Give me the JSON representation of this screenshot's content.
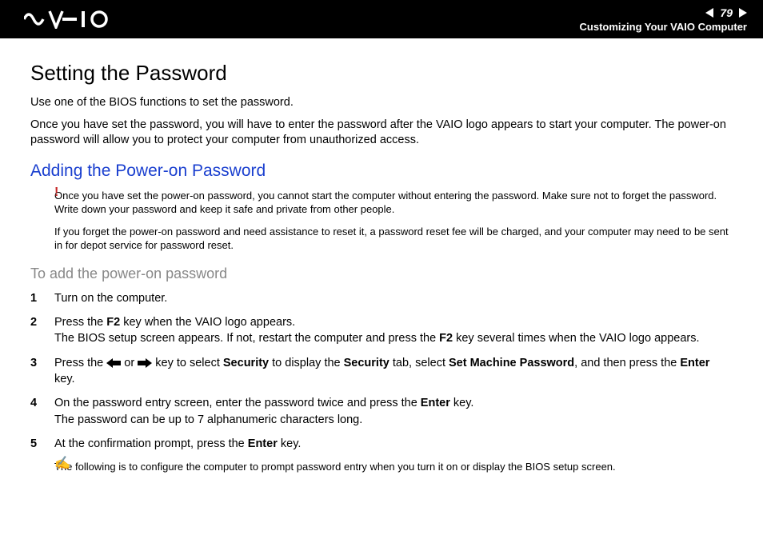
{
  "header": {
    "page_number": "79",
    "section_title": "Customizing Your VAIO Computer"
  },
  "main": {
    "title": "Setting the Password",
    "intro1": "Use one of the BIOS functions to set the password.",
    "intro2": "Once you have set the password, you will have to enter the password after the VAIO logo appears to start your computer. The power-on password will allow you to protect your computer from unauthorized access.",
    "subheading": "Adding the Power-on Password",
    "warning1": "Once you have set the power-on password, you cannot start the computer without entering the password. Make sure not to forget the password. Write down your password and keep it safe and private from other people.",
    "warning2": "If you forget the power-on password and need assistance to reset it, a password reset fee will be charged, and your computer may need to be sent in for depot service for password reset.",
    "procedure_title": "To add the power-on password",
    "steps": {
      "s1": "Turn on the computer.",
      "s2a": "Press the ",
      "s2_f2a": "F2",
      "s2b": " key when the VAIO logo appears.",
      "s2c": "The BIOS setup screen appears. If not, restart the computer and press the ",
      "s2_f2b": "F2",
      "s2d": " key several times when the VAIO logo appears.",
      "s3a": "Press the ",
      "s3b": " or ",
      "s3c": " key to select ",
      "s3_sec1": "Security",
      "s3d": " to display the ",
      "s3_sec2": "Security",
      "s3e": " tab, select ",
      "s3_smp": "Set Machine Password",
      "s3f": ", and then press the ",
      "s3_enter": "Enter",
      "s3g": " key.",
      "s4a": "On the password entry screen, enter the password twice and press the ",
      "s4_enter": "Enter",
      "s4b": " key.",
      "s4c": "The password can be up to 7 alphanumeric characters long.",
      "s5a": "At the confirmation prompt, press the ",
      "s5_enter": "Enter",
      "s5b": " key."
    },
    "note": "The following is to configure the computer to prompt password entry when you turn it on or display the BIOS setup screen."
  }
}
